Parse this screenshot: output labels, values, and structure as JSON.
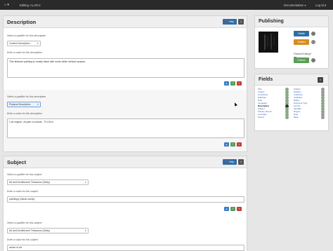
{
  "topbar": {
    "home_glyph": "⌂ ▾",
    "title": "Editing: AL.00-2",
    "documentation": "Documentation ▾",
    "logout": "Log Out"
  },
  "description": {
    "heading": "Description",
    "help": "❓ Help",
    "close": "×",
    "entries": [
      {
        "qualifier_prompt": "Select a qualifier for this description",
        "qualifier": "Content Description",
        "value_prompt": "Enter a value for this description",
        "value": "This abstract painting is mostly black with some white vertical scrapes."
      },
      {
        "qualifier_prompt": "Select a qualifier for this description",
        "qualifier": "Physical Description",
        "value_prompt": "Enter a value for this description",
        "value": "1 art original : oil paint on canvas ; 73 x 84 in."
      }
    ]
  },
  "subject": {
    "heading": "Subject",
    "help": "❓ Help",
    "close": "×",
    "entries": [
      {
        "qualifier_prompt": "Select a qualifier for this subject",
        "qualifier": "Art and Architecture Thesaurus (Getty)",
        "value_prompt": "Enter a value for this subject",
        "value": "paintings (visual works)"
      },
      {
        "qualifier_prompt": "Select a qualifier for this subject",
        "qualifier": "Art and Architecture Thesaurus (Getty)",
        "value_prompt": "Enter a value for this subject",
        "value": "works of art"
      }
    ]
  },
  "publishing": {
    "heading": "Publishing",
    "visible": "Visible",
    "hidden": "Hidden",
    "finished_editing": "Finished Editing?",
    "publish": "Publish"
  },
  "fields": {
    "heading": "Fields",
    "left": [
      "Title",
      "Creator",
      "Contributor",
      "Publisher",
      "Date",
      "Language",
      "Description",
      "Subject",
      "Primary Source",
      "Coverage",
      "Source"
    ],
    "right": [
      "Citation",
      "Relation",
      "Collection",
      "Institution",
      "Rights",
      "Resource Type",
      "Format",
      "Identifier",
      "Degree",
      "Note",
      "Meta"
    ],
    "current": "Description"
  },
  "colors": {
    "help_blue": "#2e6da4",
    "visible_blue": "#2e6da4",
    "hidden_orange": "#d88c1f",
    "publish_green": "#5a9e57"
  }
}
